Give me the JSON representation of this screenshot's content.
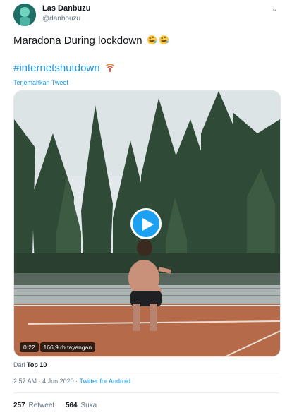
{
  "user": {
    "name": "Las Danbuzu",
    "handle": "@danbouzu",
    "avatar_color": "#2e7d6f"
  },
  "tweet": {
    "line1": "Maradona During lockdown",
    "line2": "#internetshutdown",
    "translate": "Terjemahkan Tweet"
  },
  "video": {
    "duration": "0:22",
    "views": "166,9 rb tayangan"
  },
  "source": {
    "prefix": "Dari",
    "name": "Top 10"
  },
  "meta": {
    "time": "2.57 AM",
    "separator1": "·",
    "date": "4 Jun 2020",
    "separator2": "·",
    "client": "Twitter for Android"
  },
  "stats": {
    "retweets": "257",
    "retweets_label": "Retweet",
    "likes": "564",
    "likes_label": "Suka"
  },
  "colors": {
    "link": "#1b95e0",
    "play_button": "#1da1f2"
  },
  "icons": {
    "caret": "chevron-down-icon",
    "emoji1": "rolling-on-floor-laughing-icon",
    "emoji2": "rolling-on-floor-laughing-icon",
    "emoji3": "broadcast-icon",
    "play": "play-icon"
  }
}
